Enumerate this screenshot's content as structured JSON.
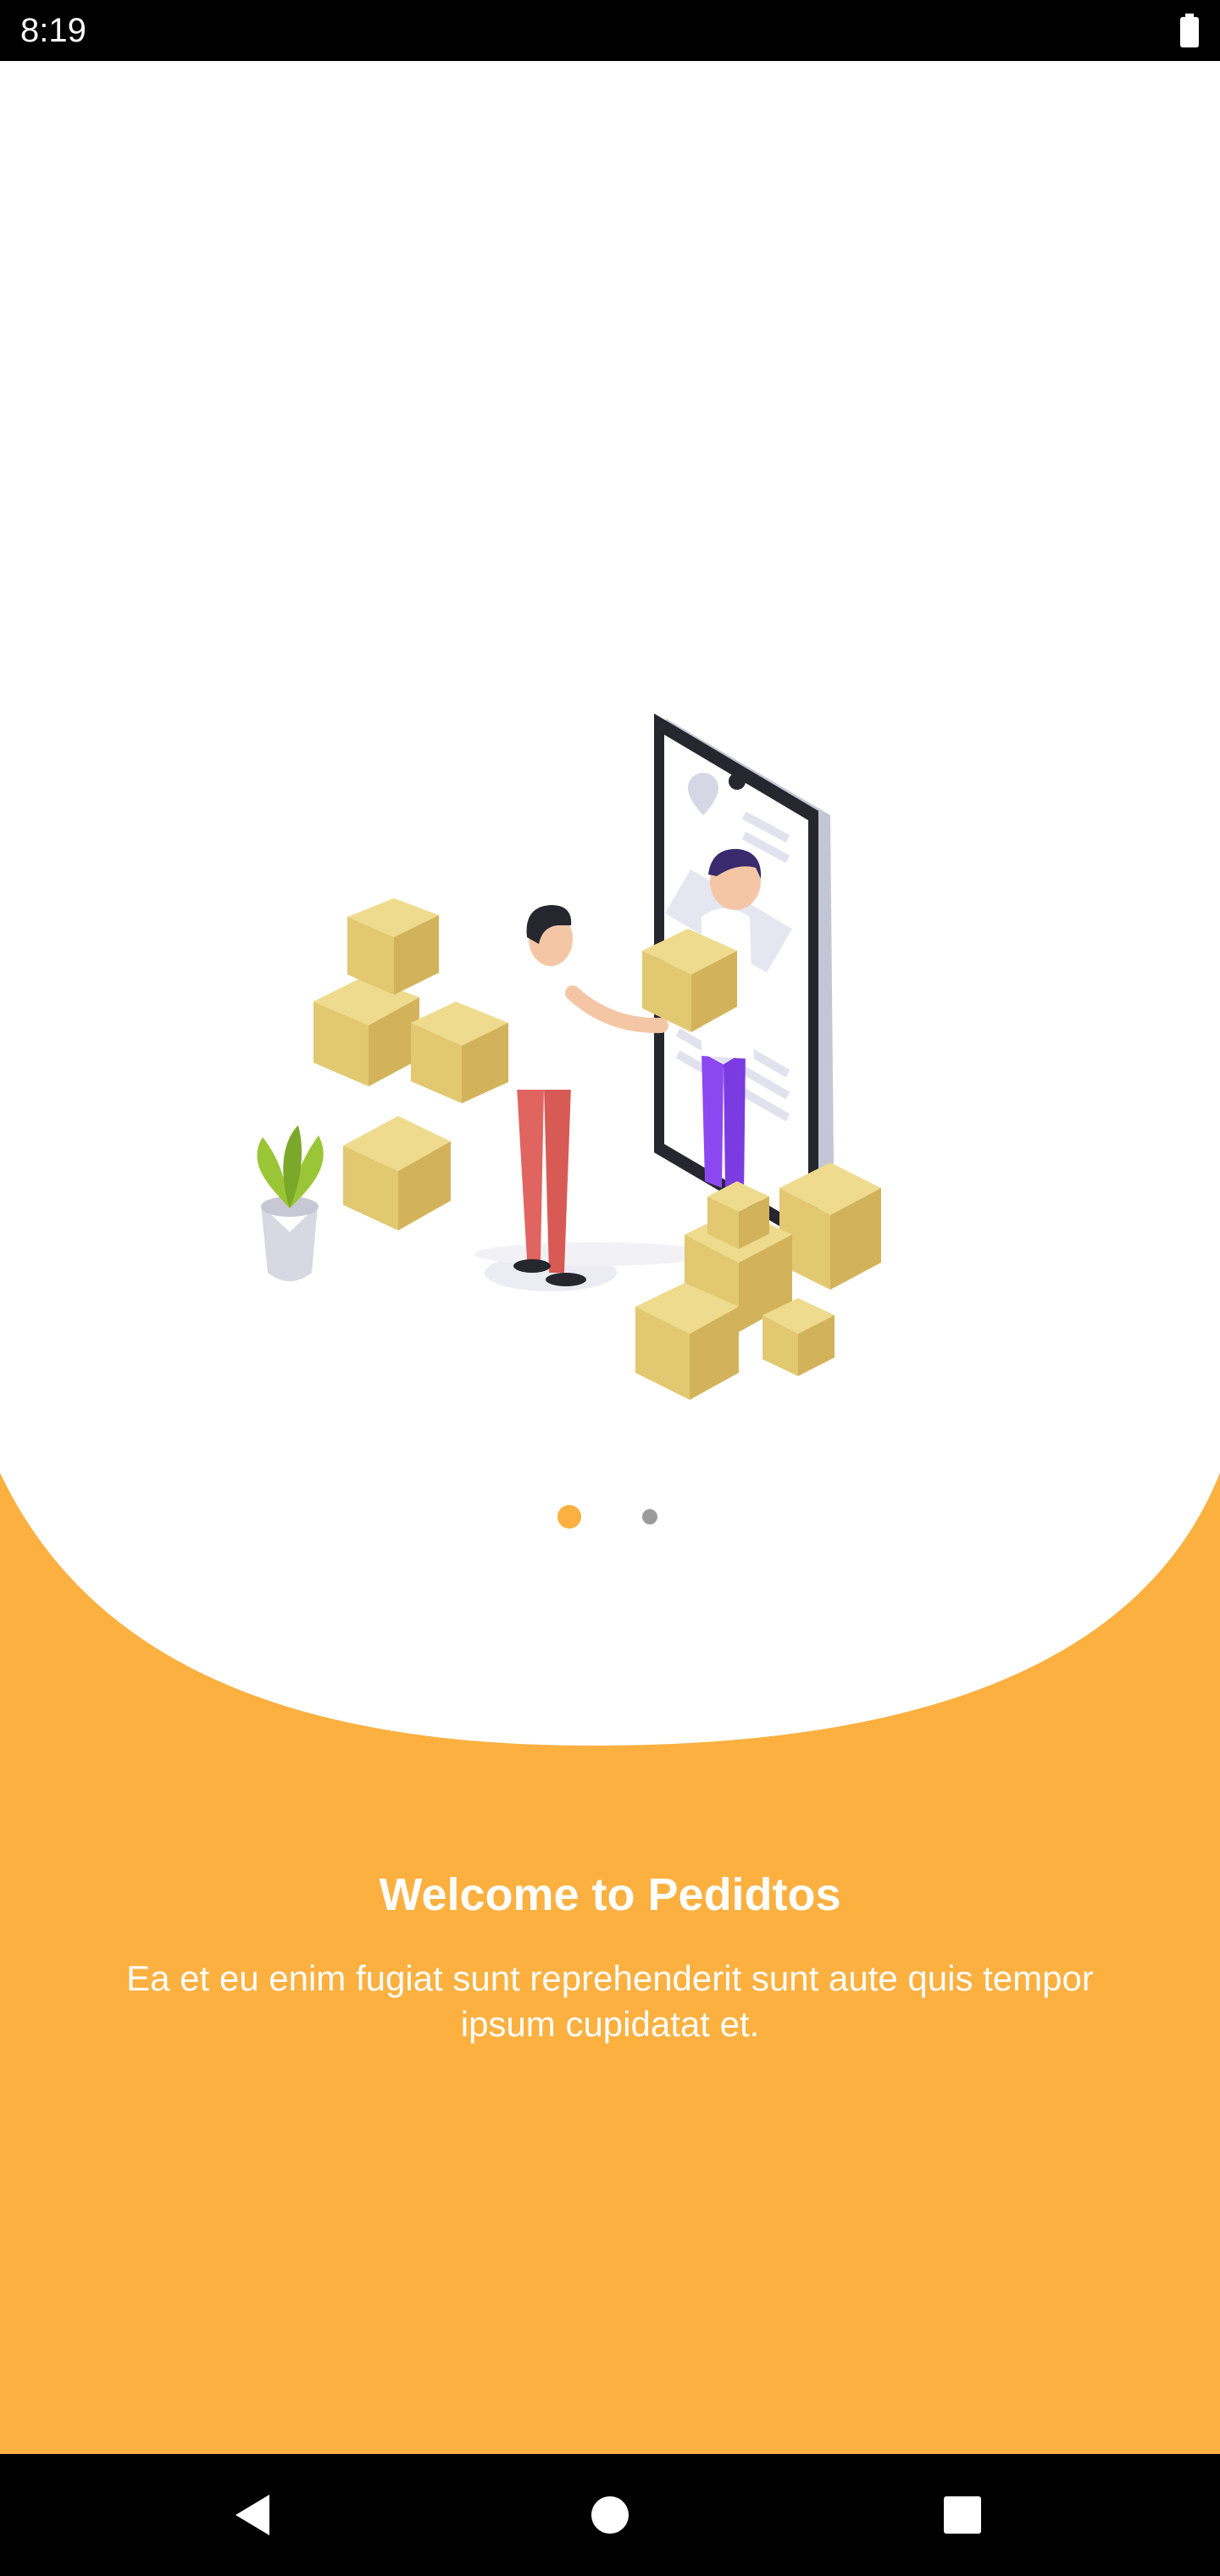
{
  "status_bar": {
    "time": "8:19",
    "battery_icon": "battery-full-icon"
  },
  "illustration": {
    "name": "delivery-illustration"
  },
  "pager": {
    "pages": 2,
    "current": 1,
    "active_color": "#FBB040",
    "inactive_color": "#9a9a9a"
  },
  "onboarding": {
    "title": "Welcome to Pedidtos",
    "description": "Ea et eu enim fugiat sunt reprehenderit sunt aute quis tempor ipsum cupidatat et."
  },
  "nav_bar": {
    "back_icon": "back-triangle-icon",
    "home_icon": "home-circle-icon",
    "recents_icon": "recents-square-icon"
  },
  "colors": {
    "accent": "#FBB040",
    "background": "#ffffff",
    "system_bar": "#000000"
  }
}
